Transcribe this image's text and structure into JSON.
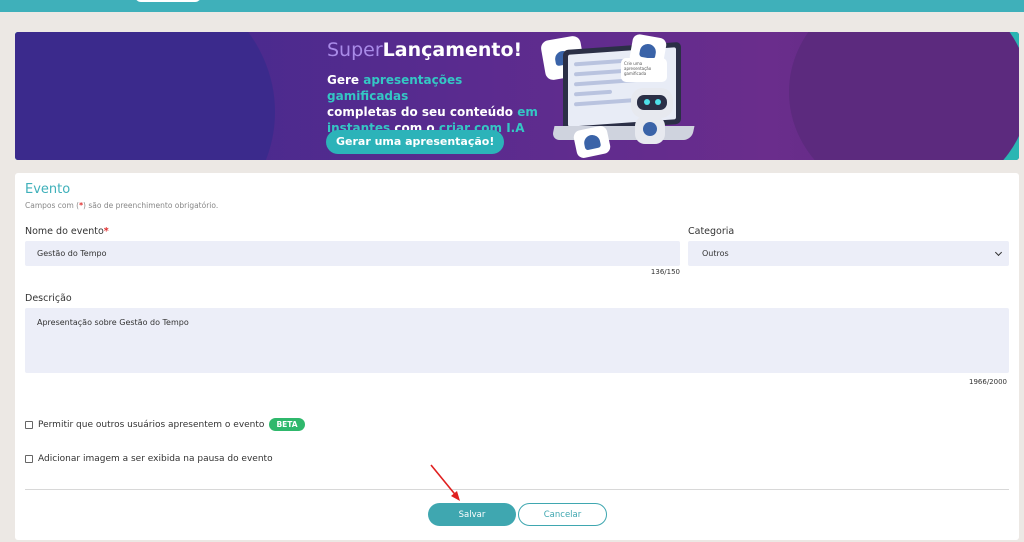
{
  "banner": {
    "title_super": "Super",
    "title_main": "Lançamento!",
    "line1_a": "Gere ",
    "line1_hl": "apresentações gamificadas",
    "line2": "completas do seu conteúdo ",
    "line2_hl": "em",
    "line3_hl": "instantes",
    "line3_a": " com o ",
    "line3_hl2": "criar com I.A",
    "button_label": "Gerar uma apresentação!",
    "bubble_text": "Crie uma apresentação gamificada"
  },
  "form": {
    "title": "Evento",
    "hint_before": "Campos com (",
    "hint_star": "*",
    "hint_after": ") são de preenchimento obrigatório.",
    "event_name": {
      "label": "Nome do evento",
      "required_mark": "*",
      "value": "Gestão do Tempo",
      "counter": "136/150"
    },
    "category": {
      "label": "Categoria",
      "selected": "Outros"
    },
    "description": {
      "label": "Descrição",
      "value": "Apresentação sobre Gestão do Tempo",
      "counter": "1966/2000"
    },
    "allow_others": {
      "label": "Permitir que outros usuários apresentem o evento",
      "checked": false,
      "badge": "BETA",
      "badge_color": "#2fb86c"
    },
    "add_image": {
      "label": "Adicionar imagem a ser exibida na pausa do evento",
      "checked": false
    },
    "buttons": {
      "save": "Salvar",
      "cancel": "Cancelar"
    }
  },
  "colors": {
    "accent": "#3fb0ba",
    "topbar": "#3fb0ba",
    "required": "#e03030",
    "annotation_arrow": "#e02020"
  }
}
